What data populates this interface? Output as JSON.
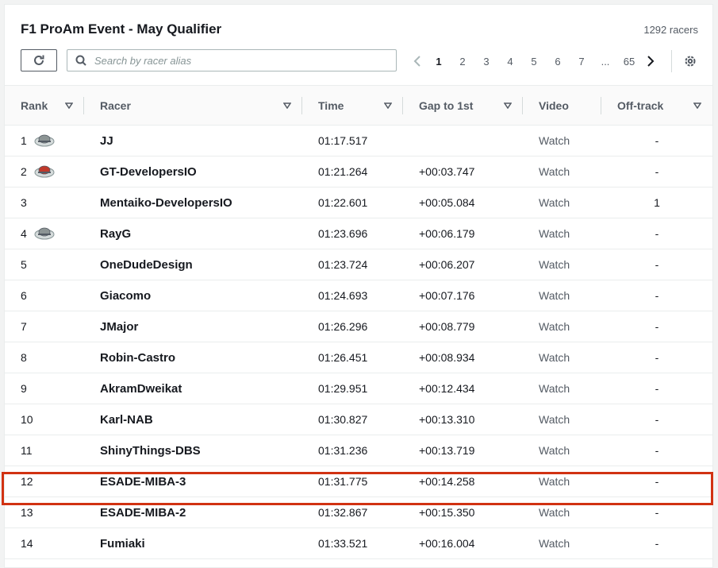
{
  "header": {
    "title": "F1 ProAm Event - May Qualifier",
    "racer_count": "1292 racers"
  },
  "search": {
    "placeholder": "Search by racer alias",
    "value": ""
  },
  "pagination": {
    "pages": [
      "1",
      "2",
      "3",
      "4",
      "5",
      "6",
      "7",
      "...",
      "65"
    ],
    "current": "1"
  },
  "table": {
    "columns": [
      "Rank",
      "Racer",
      "Time",
      "Gap to 1st",
      "Video",
      "Off-track"
    ],
    "rows": [
      {
        "rank": "1",
        "badge": "silver",
        "racer": "JJ",
        "time": "01:17.517",
        "gap": "",
        "video": "Watch",
        "offtrack": "-"
      },
      {
        "rank": "2",
        "badge": "red",
        "racer": "GT-DevelopersIO",
        "time": "01:21.264",
        "gap": "+00:03.747",
        "video": "Watch",
        "offtrack": "-"
      },
      {
        "rank": "3",
        "badge": "",
        "racer": "Mentaiko-DevelopersIO",
        "time": "01:22.601",
        "gap": "+00:05.084",
        "video": "Watch",
        "offtrack": "1"
      },
      {
        "rank": "4",
        "badge": "silver",
        "racer": "RayG",
        "time": "01:23.696",
        "gap": "+00:06.179",
        "video": "Watch",
        "offtrack": "-"
      },
      {
        "rank": "5",
        "badge": "",
        "racer": "OneDudeDesign",
        "time": "01:23.724",
        "gap": "+00:06.207",
        "video": "Watch",
        "offtrack": "-"
      },
      {
        "rank": "6",
        "badge": "",
        "racer": "Giacomo",
        "time": "01:24.693",
        "gap": "+00:07.176",
        "video": "Watch",
        "offtrack": "-"
      },
      {
        "rank": "7",
        "badge": "",
        "racer": "JMajor",
        "time": "01:26.296",
        "gap": "+00:08.779",
        "video": "Watch",
        "offtrack": "-"
      },
      {
        "rank": "8",
        "badge": "",
        "racer": "Robin-Castro",
        "time": "01:26.451",
        "gap": "+00:08.934",
        "video": "Watch",
        "offtrack": "-"
      },
      {
        "rank": "9",
        "badge": "",
        "racer": "AkramDweikat",
        "time": "01:29.951",
        "gap": "+00:12.434",
        "video": "Watch",
        "offtrack": "-"
      },
      {
        "rank": "10",
        "badge": "",
        "racer": "Karl-NAB",
        "time": "01:30.827",
        "gap": "+00:13.310",
        "video": "Watch",
        "offtrack": "-"
      },
      {
        "rank": "11",
        "badge": "",
        "racer": "ShinyThings-DBS",
        "time": "01:31.236",
        "gap": "+00:13.719",
        "video": "Watch",
        "offtrack": "-"
      },
      {
        "rank": "12",
        "badge": "",
        "racer": "ESADE-MIBA-3",
        "time": "01:31.775",
        "gap": "+00:14.258",
        "video": "Watch",
        "offtrack": "-"
      },
      {
        "rank": "13",
        "badge": "",
        "racer": "ESADE-MIBA-2",
        "time": "01:32.867",
        "gap": "+00:15.350",
        "video": "Watch",
        "offtrack": "-"
      },
      {
        "rank": "14",
        "badge": "",
        "racer": "Fumiaki",
        "time": "01:33.521",
        "gap": "+00:16.004",
        "video": "Watch",
        "offtrack": "-"
      }
    ],
    "highlighted_row": "12"
  },
  "colors": {
    "highlight": "#d13212",
    "header_bg": "#fafafa",
    "text": "#16191f",
    "muted": "#545b64"
  },
  "icons": {
    "refresh": "refresh-icon",
    "search": "search-icon",
    "prev": "chevron-left-icon",
    "next": "chevron-right-icon",
    "settings": "gear-icon",
    "sort": "caret-down-icon"
  }
}
